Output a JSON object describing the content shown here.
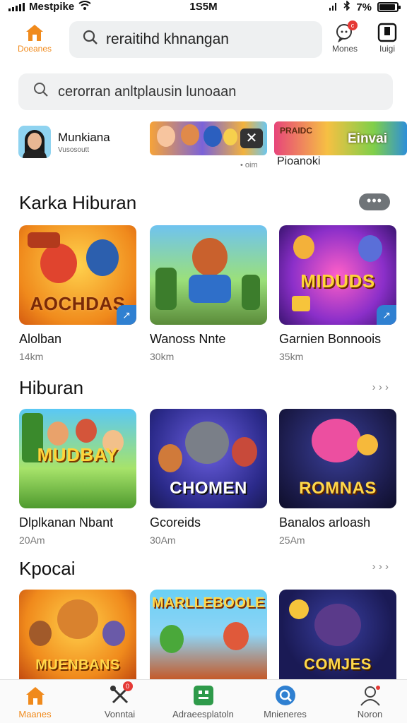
{
  "status": {
    "carrier": "Mestpike",
    "time": "1S5M",
    "battery": "7%"
  },
  "header": {
    "home_label": "Doeanes",
    "search_text": "reraitihd khnangan",
    "notifications_label": "Mones",
    "notifications_badge": "c",
    "right_label": "Iuigi"
  },
  "search2": {
    "text": "cerorran anltplausin lunoaan"
  },
  "stories": {
    "profile_name": "Munkiana",
    "profile_sub": "Vusosoutt",
    "banner1_title": "",
    "banner_small": "• oim",
    "banner2_tag": "PRAIDC",
    "banner2_title": "Einvai",
    "banner2_label": "Pioanoki"
  },
  "sections": [
    {
      "title": "Karka Hiburan",
      "more": "•••",
      "cards": [
        {
          "title": "Alolban",
          "sub": "14km",
          "art": "AOCHDAS"
        },
        {
          "title": "Wanoss Nnte",
          "sub": "30km",
          "art": ""
        },
        {
          "title": "Garnien Bonnoois",
          "sub": "35km",
          "art": "MIDUDS"
        }
      ]
    },
    {
      "title": "Hiburan",
      "more": "› › ›",
      "cards": [
        {
          "title": "Dlplkanan Nbant",
          "sub": "20Am",
          "art": "MUDBAY"
        },
        {
          "title": "Gcoreids",
          "sub": "30Am",
          "art": "CHOMEN"
        },
        {
          "title": "Banalos arloash",
          "sub": "25Am",
          "art": "ROMNAS"
        }
      ]
    },
    {
      "title": "Kpocai",
      "more": "› › ›",
      "cards": [
        {
          "title": "",
          "sub": "",
          "art": "MUENBANS"
        },
        {
          "title": "",
          "sub": "",
          "art": "MARLLEBOOLE"
        },
        {
          "title": "",
          "sub": "",
          "art": "COMJES"
        }
      ]
    }
  ],
  "bottom_nav": [
    {
      "label": "Maanes",
      "icon": "home-icon"
    },
    {
      "label": "Vonntai",
      "icon": "tools-icon",
      "badge": "0"
    },
    {
      "label": "Adraeesplatoln",
      "icon": "grid-icon"
    },
    {
      "label": "Mnieneres",
      "icon": "search-icon"
    },
    {
      "label": "Noron",
      "icon": "profile-icon"
    }
  ],
  "colors": {
    "accent": "#f08a1c",
    "blue": "#2f80d1"
  }
}
